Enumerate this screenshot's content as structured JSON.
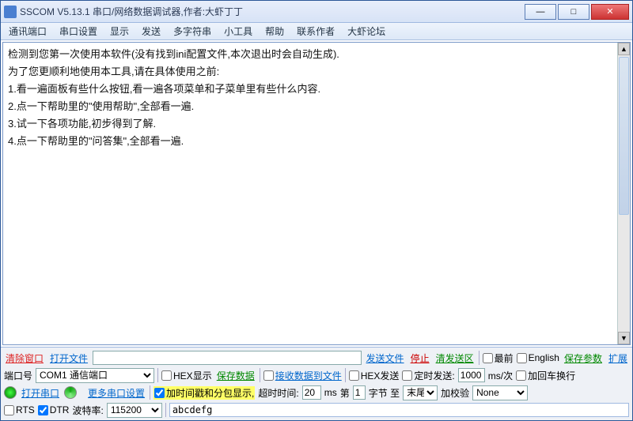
{
  "title": "SSCOM V5.13.1 串口/网络数据调试器,作者:大虾丁丁",
  "menu": [
    "通讯端口",
    "串口设置",
    "显示",
    "发送",
    "多字符串",
    "小工具",
    "帮助",
    "联系作者",
    "大虾论坛"
  ],
  "output": "检测到您第一次使用本软件(没有找到ini配置文件,本次退出时会自动生成).\n为了您更顺利地使用本工具,请在具体使用之前:\n1.看一遍面板有些什么按钮,看一遍各项菜单和子菜单里有些什么内容.\n2.点一下帮助里的\"使用帮助\",全部看一遍.\n3.试一下各项功能,初步得到了解.\n4.点一下帮助里的\"问答集\",全部看一遍.",
  "buttons": {
    "clear": "清除窗口",
    "openfile": "打开文件",
    "sendfile": "发送文件",
    "stop": "停止",
    "clearsend": "清发送区",
    "saveparam": "保存参数",
    "expand": "扩展",
    "openport": "打开串口",
    "moreserial": "更多串口设置",
    "savedata": "保存数据"
  },
  "labels": {
    "top": "最前",
    "english": "English",
    "port": "端口号",
    "portval": "COM1 通信端口",
    "hexdisp": "HEX显示",
    "recvtofile": "接收数据到文件",
    "hexsend": "HEX发送",
    "timedsend": "定时发送:",
    "interval_val": "1000",
    "interval_unit": "ms/次",
    "addcr": "加回车换行",
    "rts": "RTS",
    "dtr": "DTR",
    "baud": "波特率:",
    "baudval": "115200",
    "timestamp": "加时间戳和分包显示,",
    "timeout": "超时时间:",
    "timeout_val": "20",
    "timeout_unit": "ms",
    "frame1": "第",
    "frame1v": "1",
    "frame2": "字节 至",
    "frame_end": "末尾",
    "checksum": "加校验",
    "checksumval": "None",
    "sendtext": "abcdefg"
  }
}
